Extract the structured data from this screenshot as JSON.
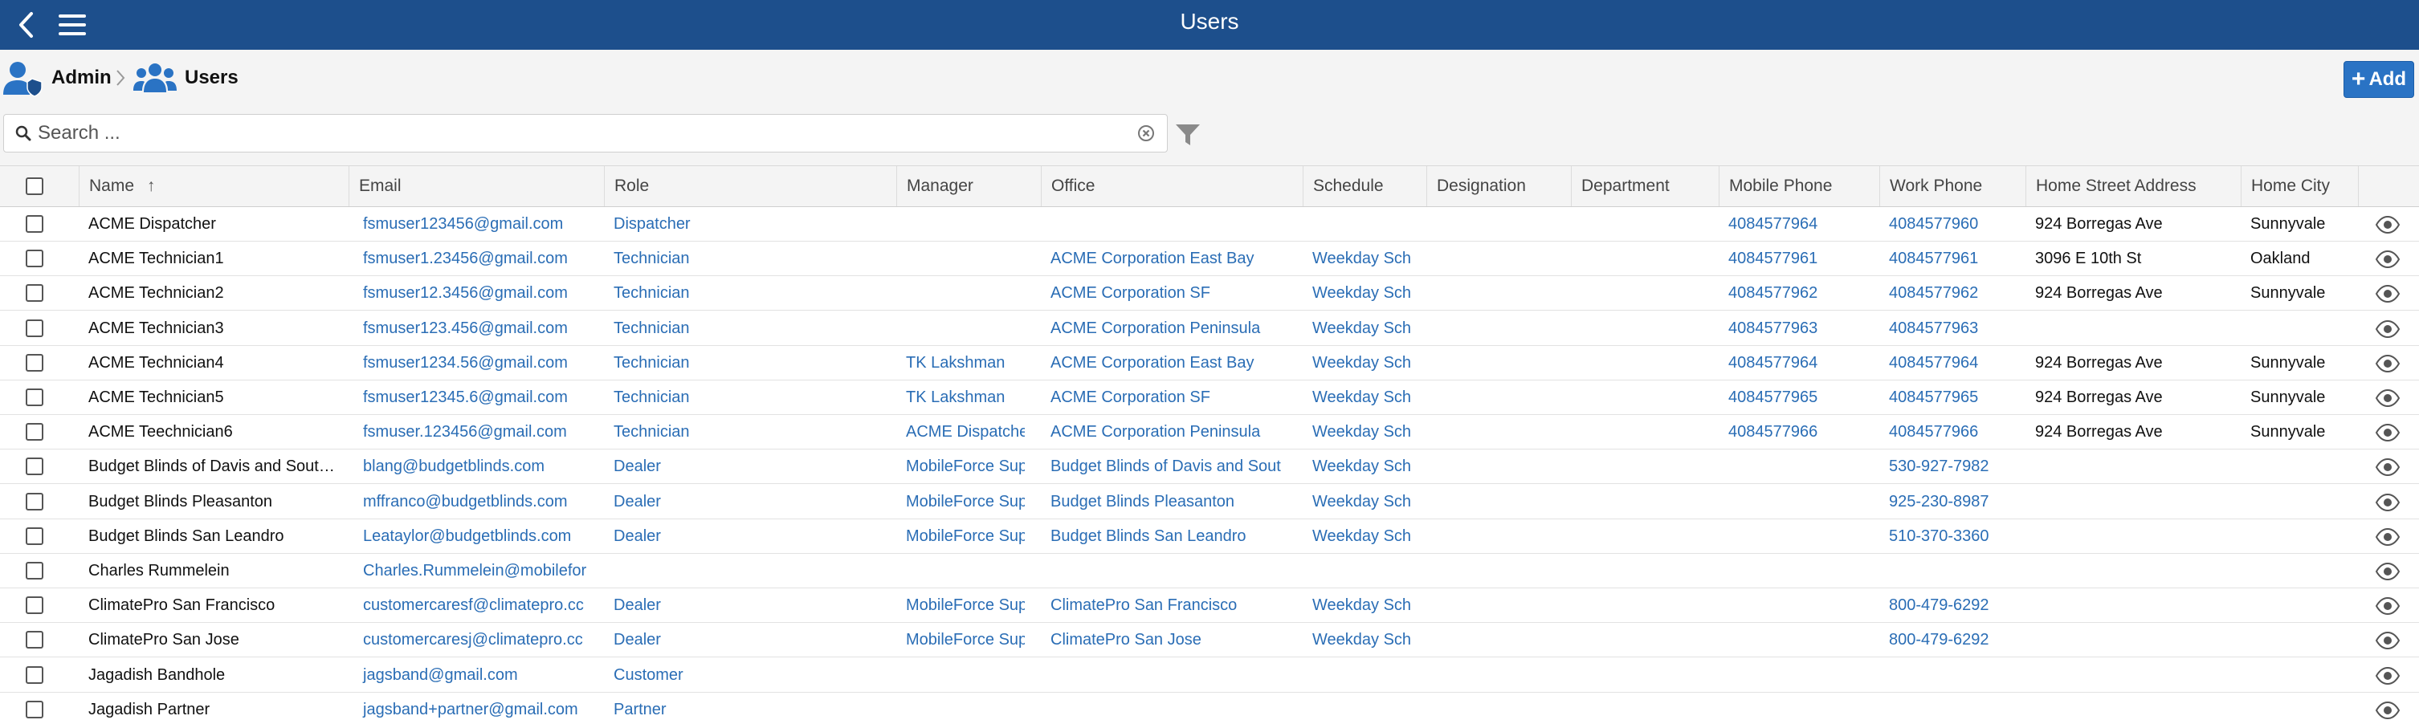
{
  "app": {
    "title": "Users"
  },
  "breadcrumb": {
    "root": "Admin",
    "current": "Users"
  },
  "toolbar": {
    "add_label": "Add"
  },
  "search": {
    "placeholder": "Search ...",
    "value": ""
  },
  "table": {
    "sort": {
      "column": "Name",
      "direction": "ascending"
    },
    "columns": [
      "Name",
      "Email",
      "Role",
      "Manager",
      "Office",
      "Schedule",
      "Designation",
      "Department",
      "Mobile Phone",
      "Work Phone",
      "Home Street Address",
      "Home City"
    ],
    "rows": [
      [
        "ACME Dispatcher",
        "fsmuser123456@gmail.com",
        "Dispatcher",
        "",
        "",
        "",
        "",
        "",
        "4084577964",
        "4084577960",
        "924 Borregas Ave",
        "Sunnyvale"
      ],
      [
        "ACME Technician1",
        "fsmuser1.23456@gmail.com",
        "Technician",
        "",
        "ACME Corporation East Bay",
        "Weekday Sch",
        "",
        "",
        "4084577961",
        "4084577961",
        "3096 E 10th St",
        "Oakland"
      ],
      [
        "ACME Technician2",
        "fsmuser12.3456@gmail.com",
        "Technician",
        "",
        "ACME Corporation SF",
        "Weekday Sch",
        "",
        "",
        "4084577962",
        "4084577962",
        "924 Borregas Ave",
        "Sunnyvale"
      ],
      [
        "ACME Technician3",
        "fsmuser123.456@gmail.com",
        "Technician",
        "",
        "ACME Corporation Peninsula",
        "Weekday Sch",
        "",
        "",
        "4084577963",
        "4084577963",
        "",
        ""
      ],
      [
        "ACME Technician4",
        "fsmuser1234.56@gmail.com",
        "Technician",
        "TK Lakshman",
        "ACME Corporation East Bay",
        "Weekday Sch",
        "",
        "",
        "4084577964",
        "4084577964",
        "924 Borregas Ave",
        "Sunnyvale"
      ],
      [
        "ACME Technician5",
        "fsmuser12345.6@gmail.com",
        "Technician",
        "TK Lakshman",
        "ACME Corporation SF",
        "Weekday Sch",
        "",
        "",
        "4084577965",
        "4084577965",
        "924 Borregas Ave",
        "Sunnyvale"
      ],
      [
        "ACME Teechnician6",
        "fsmuser.123456@gmail.com",
        "Technician",
        "ACME Dispatche",
        "ACME Corporation Peninsula",
        "Weekday Sch",
        "",
        "",
        "4084577966",
        "4084577966",
        "924 Borregas Ave",
        "Sunnyvale"
      ],
      [
        "Budget Blinds of Davis and Sout…",
        "blang@budgetblinds.com",
        "Dealer",
        "MobileForce Sup",
        "Budget Blinds of Davis and Sout",
        "Weekday Sch",
        "",
        "",
        "",
        "530-927-7982",
        "",
        ""
      ],
      [
        "Budget Blinds Pleasanton",
        "mffranco@budgetblinds.com",
        "Dealer",
        "MobileForce Sup",
        "Budget Blinds Pleasanton",
        "Weekday Sch",
        "",
        "",
        "",
        "925-230-8987",
        "",
        ""
      ],
      [
        "Budget Blinds San Leandro",
        "Leataylor@budgetblinds.com",
        "Dealer",
        "MobileForce Sup",
        "Budget Blinds San Leandro",
        "Weekday Sch",
        "",
        "",
        "",
        "510-370-3360",
        "",
        ""
      ],
      [
        "Charles Rummelein",
        "Charles.Rummelein@mobilefor",
        "",
        "",
        "",
        "",
        "",
        "",
        "",
        "",
        "",
        ""
      ],
      [
        "ClimatePro San Francisco",
        "customercaresf@climatepro.cc",
        "Dealer",
        "MobileForce Sup",
        "ClimatePro San Francisco",
        "Weekday Sch",
        "",
        "",
        "",
        "800-479-6292",
        "",
        ""
      ],
      [
        "ClimatePro San Jose",
        "customercaresj@climatepro.cc",
        "Dealer",
        "MobileForce Sup",
        "ClimatePro San Jose",
        "Weekday Sch",
        "",
        "",
        "",
        "800-479-6292",
        "",
        ""
      ],
      [
        "Jagadish Bandhole",
        "jagsband@gmail.com",
        "Customer",
        "",
        "",
        "",
        "",
        "",
        "",
        "",
        "",
        ""
      ],
      [
        "Jagadish Partner",
        "jagsband+partner@gmail.com",
        "Partner",
        "",
        "",
        "",
        "",
        "",
        "",
        "",
        "",
        ""
      ]
    ]
  },
  "colors": {
    "header_bar": "#1d4f8c",
    "accent": "#2a73c4",
    "link": "#2a6db5"
  },
  "icons": [
    "back-icon",
    "menu-icon",
    "admin-icon",
    "users-icon",
    "search-icon",
    "clear-icon",
    "filter-icon",
    "sort-up-icon",
    "settings-icon",
    "view-icon"
  ]
}
